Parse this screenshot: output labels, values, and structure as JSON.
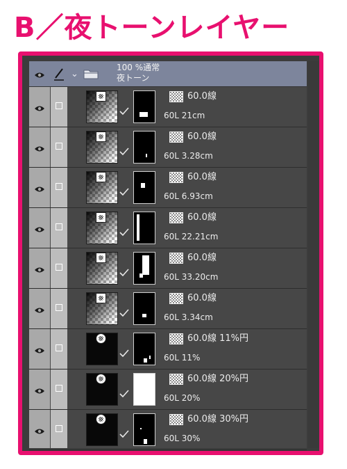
{
  "title": "B／夜トーンレイヤー",
  "colors": {
    "accent": "#e8106f",
    "panel_bg": "#474747",
    "folder_highlight": "#7d859c"
  },
  "folder": {
    "blend_info": "100 %通常",
    "name": "夜トーン",
    "icons": [
      "eye-icon",
      "pen-icon",
      "chevron-down-icon",
      "folder-icon"
    ]
  },
  "layers": [
    {
      "tone_label": "60.0線",
      "name": "60L 21cm",
      "thumb": "gradient",
      "badge": "square"
    },
    {
      "tone_label": "60.0線",
      "name": "60L 3.28cm",
      "thumb": "gradient",
      "badge": "square"
    },
    {
      "tone_label": "60.0線",
      "name": "60L 6.93cm",
      "thumb": "gradient",
      "badge": "square"
    },
    {
      "tone_label": "60.0線",
      "name": "60L 22.21cm",
      "thumb": "gradient",
      "badge": "square"
    },
    {
      "tone_label": "60.0線",
      "name": "60L 33.20cm",
      "thumb": "gradient",
      "badge": "square"
    },
    {
      "tone_label": "60.0線",
      "name": "60L 3.34cm",
      "thumb": "gradient",
      "badge": "square"
    },
    {
      "tone_label": "60.0線 11%円",
      "name": "60L 11%",
      "thumb": "dark",
      "badge": "circle"
    },
    {
      "tone_label": "60.0線 20%円",
      "name": "60L 20%",
      "thumb": "dark",
      "badge": "circle"
    },
    {
      "tone_label": "60.0線 30%円",
      "name": "60L 30%",
      "thumb": "dark",
      "badge": "circle"
    }
  ]
}
